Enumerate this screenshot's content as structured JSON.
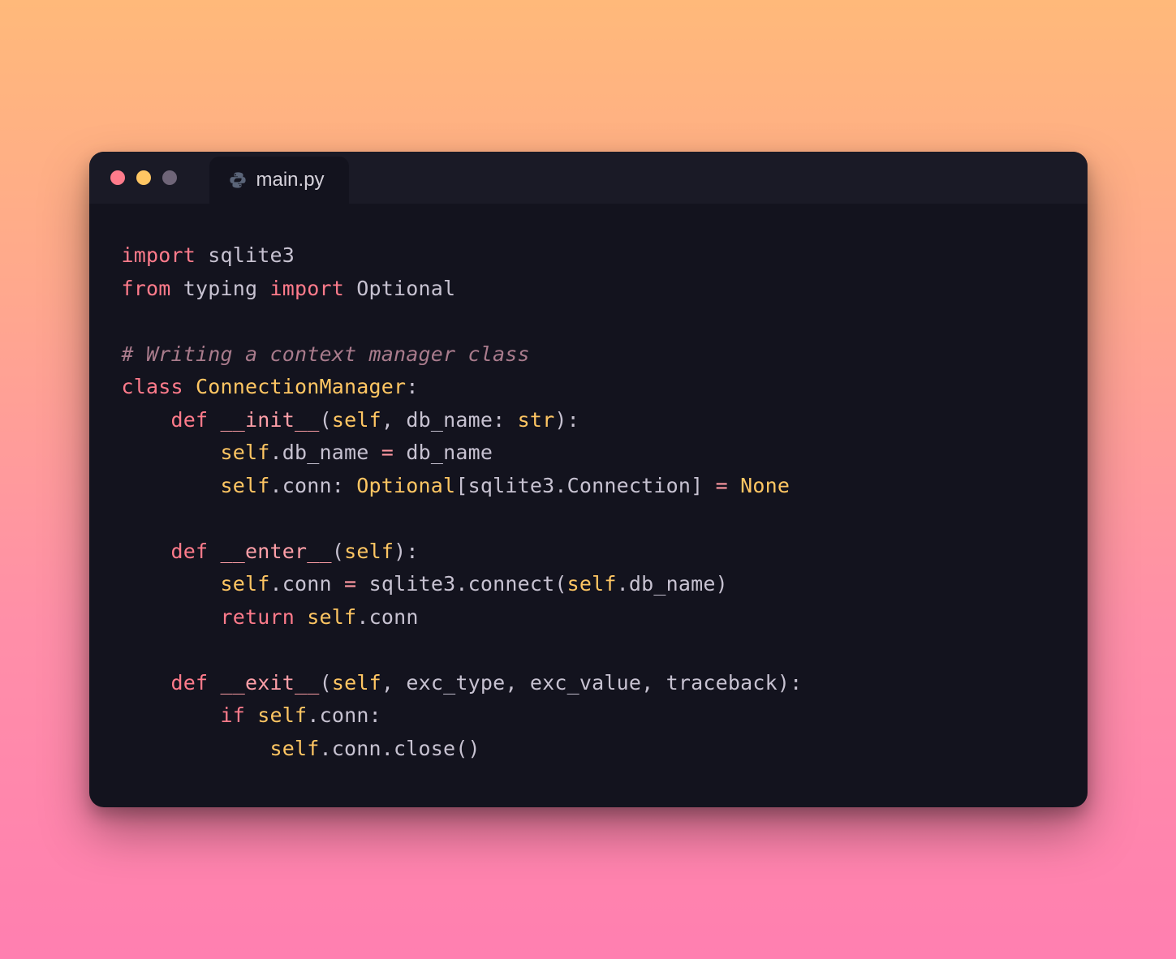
{
  "window": {
    "traffic": {
      "close_color": "#ff7b8b",
      "minimize_color": "#ffc663",
      "maximize_color": "#6f6578"
    },
    "tab": {
      "icon": "python-icon",
      "label": "main.py"
    }
  },
  "code_lines": [
    [
      {
        "cls": "kw",
        "t": "import"
      },
      {
        "cls": "pl",
        "t": " sqlite3"
      }
    ],
    [
      {
        "cls": "kw",
        "t": "from"
      },
      {
        "cls": "pl",
        "t": " typing "
      },
      {
        "cls": "kw",
        "t": "import"
      },
      {
        "cls": "pl",
        "t": " Optional"
      }
    ],
    [],
    [
      {
        "cls": "cmt",
        "t": "# Writing a context manager class"
      }
    ],
    [
      {
        "cls": "kw",
        "t": "class"
      },
      {
        "cls": "pl",
        "t": " "
      },
      {
        "cls": "cls",
        "t": "ConnectionManager"
      },
      {
        "cls": "pl",
        "t": ":"
      }
    ],
    [
      {
        "cls": "pl",
        "t": "    "
      },
      {
        "cls": "kw",
        "t": "def"
      },
      {
        "cls": "pl",
        "t": " "
      },
      {
        "cls": "fn",
        "t": "__init__"
      },
      {
        "cls": "pl",
        "t": "("
      },
      {
        "cls": "sp",
        "t": "self"
      },
      {
        "cls": "pl",
        "t": ", db_name: "
      },
      {
        "cls": "sp",
        "t": "str"
      },
      {
        "cls": "pl",
        "t": "):"
      }
    ],
    [
      {
        "cls": "pl",
        "t": "        "
      },
      {
        "cls": "sp",
        "t": "self"
      },
      {
        "cls": "pl",
        "t": ".db_name "
      },
      {
        "cls": "op",
        "t": "="
      },
      {
        "cls": "pl",
        "t": " db_name"
      }
    ],
    [
      {
        "cls": "pl",
        "t": "        "
      },
      {
        "cls": "sp",
        "t": "self"
      },
      {
        "cls": "pl",
        "t": ".conn: "
      },
      {
        "cls": "cls",
        "t": "Optional"
      },
      {
        "cls": "pl",
        "t": "[sqlite3.Connection] "
      },
      {
        "cls": "op",
        "t": "="
      },
      {
        "cls": "pl",
        "t": " "
      },
      {
        "cls": "sp",
        "t": "None"
      }
    ],
    [],
    [
      {
        "cls": "pl",
        "t": "    "
      },
      {
        "cls": "kw",
        "t": "def"
      },
      {
        "cls": "pl",
        "t": " "
      },
      {
        "cls": "fn",
        "t": "__enter__"
      },
      {
        "cls": "pl",
        "t": "("
      },
      {
        "cls": "sp",
        "t": "self"
      },
      {
        "cls": "pl",
        "t": "):"
      }
    ],
    [
      {
        "cls": "pl",
        "t": "        "
      },
      {
        "cls": "sp",
        "t": "self"
      },
      {
        "cls": "pl",
        "t": ".conn "
      },
      {
        "cls": "op",
        "t": "="
      },
      {
        "cls": "pl",
        "t": " sqlite3.connect("
      },
      {
        "cls": "sp",
        "t": "self"
      },
      {
        "cls": "pl",
        "t": ".db_name)"
      }
    ],
    [
      {
        "cls": "pl",
        "t": "        "
      },
      {
        "cls": "kw",
        "t": "return"
      },
      {
        "cls": "pl",
        "t": " "
      },
      {
        "cls": "sp",
        "t": "self"
      },
      {
        "cls": "pl",
        "t": ".conn"
      }
    ],
    [],
    [
      {
        "cls": "pl",
        "t": "    "
      },
      {
        "cls": "kw",
        "t": "def"
      },
      {
        "cls": "pl",
        "t": " "
      },
      {
        "cls": "fn",
        "t": "__exit__"
      },
      {
        "cls": "pl",
        "t": "("
      },
      {
        "cls": "sp",
        "t": "self"
      },
      {
        "cls": "pl",
        "t": ", exc_type, exc_value, traceback):"
      }
    ],
    [
      {
        "cls": "pl",
        "t": "        "
      },
      {
        "cls": "kw",
        "t": "if"
      },
      {
        "cls": "pl",
        "t": " "
      },
      {
        "cls": "sp",
        "t": "self"
      },
      {
        "cls": "pl",
        "t": ".conn:"
      }
    ],
    [
      {
        "cls": "pl",
        "t": "            "
      },
      {
        "cls": "sp",
        "t": "self"
      },
      {
        "cls": "pl",
        "t": ".conn.close()"
      }
    ]
  ]
}
